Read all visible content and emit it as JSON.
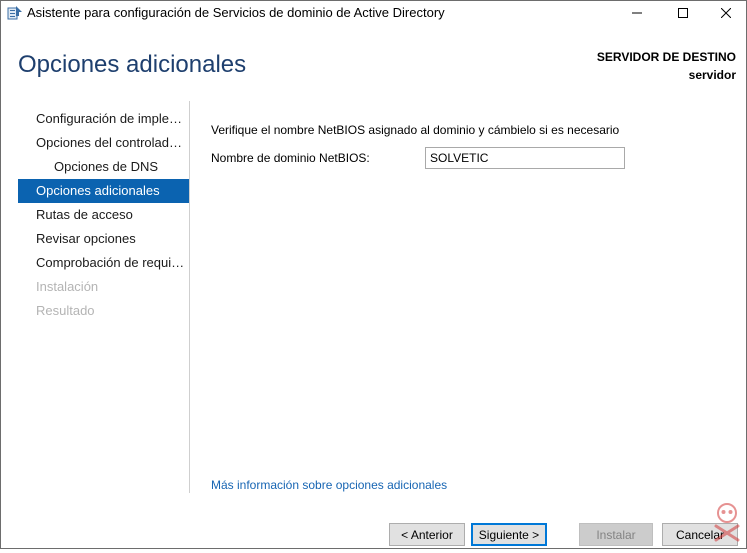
{
  "window": {
    "title": "Asistente para configuración de Servicios de dominio de Active Directory"
  },
  "header": {
    "page_title": "Opciones adicionales",
    "destination_label": "SERVIDOR DE DESTINO",
    "destination_value": "servidor"
  },
  "sidebar": {
    "items": [
      {
        "label": "Configuración de implem...",
        "state": "normal",
        "level": 0
      },
      {
        "label": "Opciones del controlador...",
        "state": "normal",
        "level": 0
      },
      {
        "label": "Opciones de DNS",
        "state": "normal",
        "level": 1
      },
      {
        "label": "Opciones adicionales",
        "state": "active",
        "level": 0
      },
      {
        "label": "Rutas de acceso",
        "state": "normal",
        "level": 0
      },
      {
        "label": "Revisar opciones",
        "state": "normal",
        "level": 0
      },
      {
        "label": "Comprobación de requisi...",
        "state": "normal",
        "level": 0
      },
      {
        "label": "Instalación",
        "state": "disabled",
        "level": 0
      },
      {
        "label": "Resultado",
        "state": "disabled",
        "level": 0
      }
    ]
  },
  "main": {
    "instruction": "Verifique el nombre NetBIOS asignado al dominio y cámbielo si es necesario",
    "netbios_label": "Nombre de dominio NetBIOS:",
    "netbios_value": "SOLVETIC",
    "more_info_link": "Más información sobre opciones adicionales"
  },
  "buttons": {
    "back": "< Anterior",
    "next": "Siguiente >",
    "install": "Instalar",
    "cancel": "Cancelar"
  },
  "colors": {
    "accent": "#0b63b0",
    "title_text": "#1e3f6e",
    "link": "#1765b3",
    "disabled_text": "#b4b4b4"
  },
  "icons": {
    "app": "server-manager-icon",
    "minimize": "minimize-icon",
    "maximize": "maximize-icon",
    "close": "close-icon",
    "watermark": "solvetic-watermark-icon"
  }
}
